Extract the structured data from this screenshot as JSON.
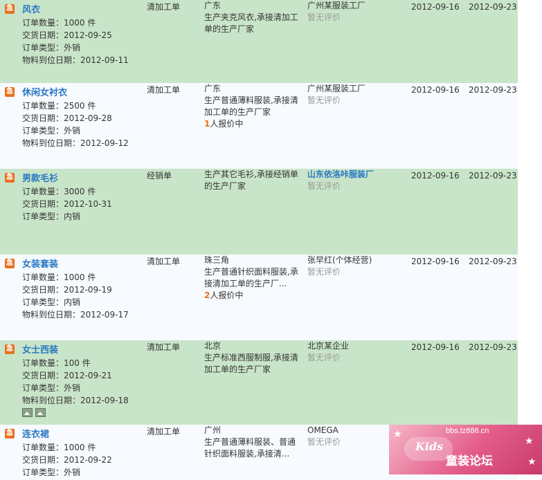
{
  "labels": {
    "urgent": "急",
    "quantity": "订单数量：",
    "delivery": "交货日期：",
    "order_type": "订单类型：",
    "material": "物料到位日期：",
    "quote_suffix": "人报价中"
  },
  "orders": [
    {
      "name": "风衣",
      "quantity": "1000 件",
      "delivery_date": "2012-09-25",
      "order_type": "外销",
      "material_date": "2012-09-11",
      "process_type": "清加工单",
      "region": "广东",
      "desc_lines": [
        "生产夹克风衣,承接清加工",
        "单的生产厂家"
      ],
      "quote_count": null,
      "company": "广州某服装工厂",
      "company_link": false,
      "rating": "暂无评价",
      "date_published": "2012-09-16",
      "date_expire": "2012-09-23",
      "has_thumbs": false
    },
    {
      "name": "休闲女衬衣",
      "quantity": "2500 件",
      "delivery_date": "2012-09-28",
      "order_type": "外销",
      "material_date": "2012-09-12",
      "process_type": "清加工单",
      "region": "广东",
      "desc_lines": [
        "生产普通薄料服装,承接清",
        "加工单的生产厂家"
      ],
      "quote_count": "1",
      "company": "广州某服装工厂",
      "company_link": false,
      "rating": "暂无评价",
      "date_published": "2012-09-16",
      "date_expire": "2012-09-23",
      "has_thumbs": false
    },
    {
      "name": "男款毛衫",
      "quantity": "3000 件",
      "delivery_date": "2012-10-31",
      "order_type": "内销",
      "material_date": null,
      "process_type": "经销单",
      "region": "",
      "desc_lines": [
        "生产其它毛衫,承接经销单",
        "的生产厂家"
      ],
      "quote_count": null,
      "company": "山东依洛咔服装厂",
      "company_link": true,
      "rating": "暂无评价",
      "date_published": "2012-09-16",
      "date_expire": "2012-09-23",
      "has_thumbs": false
    },
    {
      "name": "女装套装",
      "quantity": "1000 件",
      "delivery_date": "2012-09-19",
      "order_type": "内销",
      "material_date": "2012-09-17",
      "process_type": "清加工单",
      "region": "珠三角",
      "desc_lines": [
        "生产普通针织面料服装,承",
        "接清加工单的生产厂..."
      ],
      "quote_count": "2",
      "company": "张早红(个体经营)",
      "company_link": false,
      "rating": "暂无评价",
      "date_published": "2012-09-16",
      "date_expire": "2012-09-23",
      "has_thumbs": false
    },
    {
      "name": "女士西装",
      "quantity": "100 件",
      "delivery_date": "2012-09-21",
      "order_type": "外销",
      "material_date": "2012-09-18",
      "process_type": "清加工单",
      "region": "北京",
      "desc_lines": [
        "生产标准西服制服,承接清",
        "加工单的生产厂家"
      ],
      "quote_count": null,
      "company": "北京某企业",
      "company_link": false,
      "rating": "暂无评价",
      "date_published": "2012-09-16",
      "date_expire": "2012-09-23",
      "has_thumbs": true
    },
    {
      "name": "连衣裙",
      "quantity": "1000 件",
      "delivery_date": "2012-09-22",
      "order_type": "外销",
      "material_date": null,
      "process_type": "清加工单",
      "region": "广州",
      "desc_lines": [
        "生产普通薄料服装、普通",
        "针织面料服装,承接清..."
      ],
      "quote_count": null,
      "company": "OMEGA",
      "company_link": false,
      "rating": "暂无评价",
      "date_published": "",
      "date_expire": "",
      "has_thumbs": false
    }
  ],
  "watermark": {
    "url": "bbs.tz886.cn",
    "kids": "Kids",
    "forum": "童装论坛"
  }
}
